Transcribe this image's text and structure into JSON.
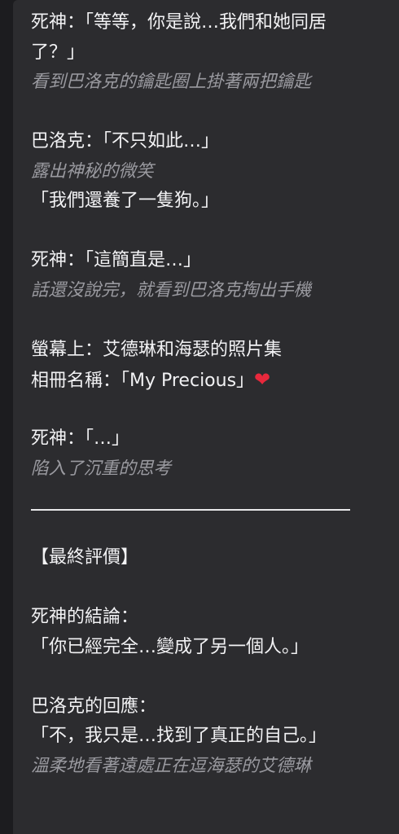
{
  "background": "#1c1c1f",
  "panel_color": "#2c2c2f",
  "text_color": "#f2f2f4",
  "action_color": "#9a9aa0",
  "heart_color": "#e8283c",
  "lines": [
    "死神：「等等，你是說…我們和她同居",
    "了？」",
    "看到巴洛克的鑰匙圈上掛著兩把鑰匙",
    "巴洛克：「不只如此…」",
    "露出神秘的微笑",
    "「我們還養了一隻狗。」",
    "死神：「這簡直是…」",
    "話還沒說完，就看到巴洛克掏出手機",
    "螢幕上：艾德琳和海瑟的照片集",
    "相冊名稱：「My Precious」",
    "❤",
    "死神：「…」",
    "陷入了沉重的思考",
    "【最終評價】",
    "死神的結論：",
    "「你已經完全…變成了另一個人。」",
    "巴洛克的回應：",
    "「不，我只是…找到了真正的自己。」",
    "溫柔地看著遠處正在逗海瑟的艾德琳"
  ],
  "heart_icon": "red-heart-emoji"
}
